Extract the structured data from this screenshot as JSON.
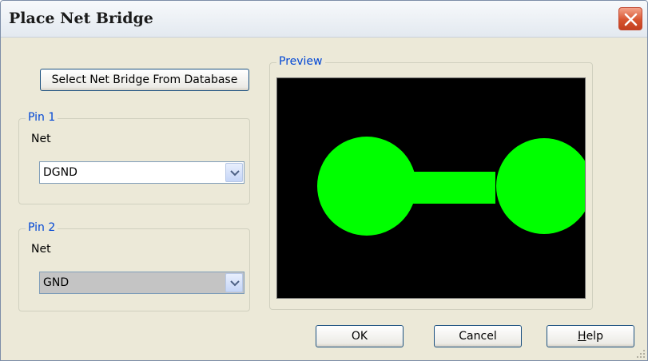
{
  "window": {
    "title": "Place Net Bridge",
    "close_icon": "close-icon"
  },
  "select_button": {
    "label": "Select Net Bridge From Database"
  },
  "pin1": {
    "legend": "Pin 1",
    "net_label": "Net",
    "net_value": "DGND"
  },
  "pin2": {
    "legend": "Pin 2",
    "net_label": "Net",
    "net_value": "GND"
  },
  "preview": {
    "legend": "Preview",
    "background_color": "#000000",
    "shape_color": "#00ff00",
    "shape_icon": "net-bridge-shape"
  },
  "buttons": {
    "ok": "OK",
    "cancel": "Cancel",
    "help": "Help",
    "help_mnemonic": "H",
    "help_rest": "elp"
  },
  "colors": {
    "accent": "#0046d5",
    "close_button": "#d7542f"
  }
}
